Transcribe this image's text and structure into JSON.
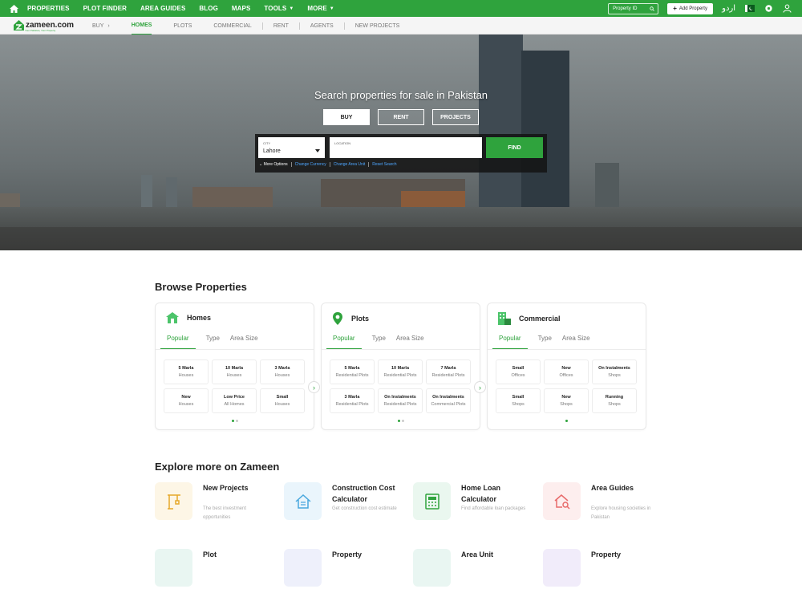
{
  "topnav": {
    "items": [
      {
        "label": "PROPERTIES"
      },
      {
        "label": "PLOT FINDER"
      },
      {
        "label": "AREA GUIDES"
      },
      {
        "label": "BLOG"
      },
      {
        "label": "MAPS"
      },
      {
        "label": "TOOLS"
      },
      {
        "label": "MORE"
      }
    ],
    "property_id_placeholder": "Property ID",
    "add_property_label": "Add Property",
    "urdu_label": "اردو"
  },
  "logo": {
    "text": "zameen.com",
    "tagline": "Your Pakistan, Your Property"
  },
  "subnav": {
    "items": [
      {
        "label": "BUY"
      },
      {
        "label": "HOMES"
      },
      {
        "label": "PLOTS"
      },
      {
        "label": "COMMERCIAL"
      },
      {
        "label": "RENT"
      },
      {
        "label": "AGENTS"
      },
      {
        "label": "NEW PROJECTS"
      }
    ],
    "active": "HOMES"
  },
  "hero": {
    "headline": "Search properties for sale in Pakistan",
    "tabs": [
      {
        "label": "BUY"
      },
      {
        "label": "RENT"
      },
      {
        "label": "PROJECTS"
      }
    ],
    "active_tab": "BUY",
    "city_label": "CITY",
    "city_value": "Lahore",
    "location_label": "LOCATION",
    "location_value": "",
    "find_label": "FIND",
    "more_options": "More Options",
    "links": [
      "Change Currency",
      "Change Area Unit",
      "Reset Search"
    ]
  },
  "browse": {
    "title": "Browse Properties",
    "tabs": [
      "Popular",
      "Type",
      "Area Size"
    ],
    "cards": [
      {
        "title": "Homes",
        "items": [
          {
            "a": "5 Marla",
            "b": "Houses"
          },
          {
            "a": "10 Marla",
            "b": "Houses"
          },
          {
            "a": "3 Marla",
            "b": "Houses"
          },
          {
            "a": "New",
            "b": "Houses"
          },
          {
            "a": "Low Price",
            "b": "All Homes"
          },
          {
            "a": "Small",
            "b": "Houses"
          }
        ]
      },
      {
        "title": "Plots",
        "items": [
          {
            "a": "5 Marla",
            "b": "Residential Plots"
          },
          {
            "a": "10 Marla",
            "b": "Residential Plots"
          },
          {
            "a": "7 Marla",
            "b": "Residential Plots"
          },
          {
            "a": "3 Marla",
            "b": "Residential Plots"
          },
          {
            "a": "On Instalments",
            "b": "Residential Plots"
          },
          {
            "a": "On Instalments",
            "b": "Commercial Plots"
          }
        ]
      },
      {
        "title": "Commercial",
        "items": [
          {
            "a": "Small",
            "b": "Offices"
          },
          {
            "a": "New",
            "b": "Offices"
          },
          {
            "a": "On Instalments",
            "b": "Shops"
          },
          {
            "a": "Small",
            "b": "Shops"
          },
          {
            "a": "New",
            "b": "Shops"
          },
          {
            "a": "Running",
            "b": "Shops"
          }
        ]
      }
    ]
  },
  "explore": {
    "title": "Explore more on Zameen",
    "items": [
      {
        "title": "New Projects",
        "desc": "The best investment opportunities",
        "color": "#fdf6e6",
        "icon": "crane-icon"
      },
      {
        "title": "Construction Cost Calculator",
        "desc": "Get construction cost estimate",
        "color": "#eaf5fc",
        "icon": "house-calculator-icon"
      },
      {
        "title": "Home Loan Calculator",
        "desc": "Find affordable loan packages",
        "color": "#eaf7ef",
        "icon": "calculator-icon"
      },
      {
        "title": "Area Guides",
        "desc": "Explore housing societies in Pakistan",
        "color": "#fdeeee",
        "icon": "house-search-icon"
      },
      {
        "title": "Plot",
        "desc": "",
        "color": "#e9f6f2",
        "icon": "plot-icon"
      },
      {
        "title": "Property",
        "desc": "",
        "color": "#eef0fb",
        "icon": "property-icon"
      },
      {
        "title": "Area Unit",
        "desc": "",
        "color": "#e9f6f2",
        "icon": "area-unit-icon"
      },
      {
        "title": "Property",
        "desc": "",
        "color": "#f1ecfa",
        "icon": "property-icon"
      }
    ]
  },
  "colors": {
    "brand": "#2fa33d",
    "link": "#4ea6ff"
  }
}
